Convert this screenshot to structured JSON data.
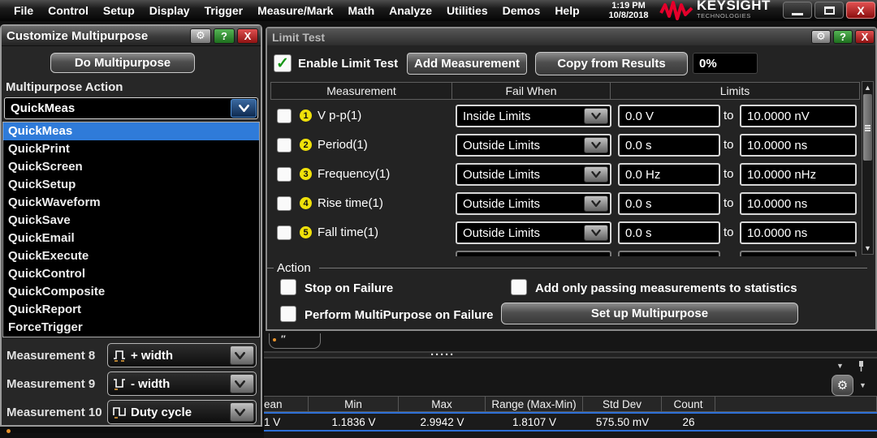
{
  "menu": {
    "items": [
      "File",
      "Control",
      "Setup",
      "Display",
      "Trigger",
      "Measure/Mark",
      "Math",
      "Analyze",
      "Utilities",
      "Demos",
      "Help"
    ],
    "clock_time": "1:19 PM",
    "clock_date": "10/8/2018",
    "brand": "KEYSIGHT",
    "brand_sub": "TECHNOLOGIES"
  },
  "left": {
    "title": "Customize Multipurpose",
    "do_button": "Do Multipurpose",
    "action_label": "Multipurpose Action",
    "combo_value": "QuickMeas",
    "list": [
      "QuickMeas",
      "QuickPrint",
      "QuickScreen",
      "QuickSetup",
      "QuickWaveform",
      "QuickSave",
      "QuickEmail",
      "QuickExecute",
      "QuickControl",
      "QuickComposite",
      "QuickReport",
      "ForceTrigger"
    ],
    "selected_item": "QuickMeas",
    "measurements": [
      {
        "label": "Measurement 8",
        "value": "+ width",
        "icon": "positive-pulse-icon"
      },
      {
        "label": "Measurement 9",
        "value": "- width",
        "icon": "negative-pulse-icon"
      },
      {
        "label": "Measurement 10",
        "value": "Duty cycle",
        "icon": "duty-cycle-icon"
      }
    ]
  },
  "limit": {
    "title": "Limit Test",
    "enable_label": "Enable Limit Test",
    "enable_checked": true,
    "add_button": "Add Measurement",
    "copy_button": "Copy from Results",
    "percent": "0%",
    "to_label": "to",
    "table": {
      "headers": [
        "Measurement",
        "Fail When",
        "Limits"
      ],
      "rows": [
        {
          "num": "1",
          "name": "V p-p(1)",
          "checked": false,
          "fail_when": "Inside Limits",
          "low": "0.0 V",
          "high": "10.0000 nV"
        },
        {
          "num": "2",
          "name": "Period(1)",
          "checked": false,
          "fail_when": "Outside Limits",
          "low": "0.0 s",
          "high": "10.0000 ns"
        },
        {
          "num": "3",
          "name": "Frequency(1)",
          "checked": false,
          "fail_when": "Outside Limits",
          "low": "0.0 Hz",
          "high": "10.0000 nHz"
        },
        {
          "num": "4",
          "name": "Rise time(1)",
          "checked": false,
          "fail_when": "Outside Limits",
          "low": "0.0 s",
          "high": "10.0000 ns"
        },
        {
          "num": "5",
          "name": "Fall time(1)",
          "checked": false,
          "fail_when": "Outside Limits",
          "low": "0.0 s",
          "high": "10.0000 ns"
        }
      ]
    },
    "action": {
      "title": "Action",
      "stop_label": "Stop on Failure",
      "passing_label": "Add only passing measurements to statistics",
      "perform_label": "Perform MultiPurpose on Failure",
      "setup_button": "Set up Multipurpose"
    }
  },
  "results": {
    "headers": [
      "ean",
      "Min",
      "Max",
      "Range (Max-Min)",
      "Std Dev",
      "Count"
    ],
    "row": [
      "1 V",
      "1.1836 V",
      "2.9942 V",
      "1.8107 V",
      "575.50 mV",
      "26"
    ]
  },
  "icons": {
    "gear": "⚙",
    "help": "?",
    "close": "X",
    "scroll_up": "▲",
    "scroll_down": "▼",
    "dropdown_tri": "▼",
    "splitter_dots": "·····"
  },
  "colors": {
    "selection_blue": "#2f7bd9",
    "badge_yellow": "#f0e10a",
    "keysight_red": "#e4002b",
    "check_green": "#159515",
    "close_red": "#8f1212",
    "result_highlight_blue": "#2d6fd6"
  }
}
